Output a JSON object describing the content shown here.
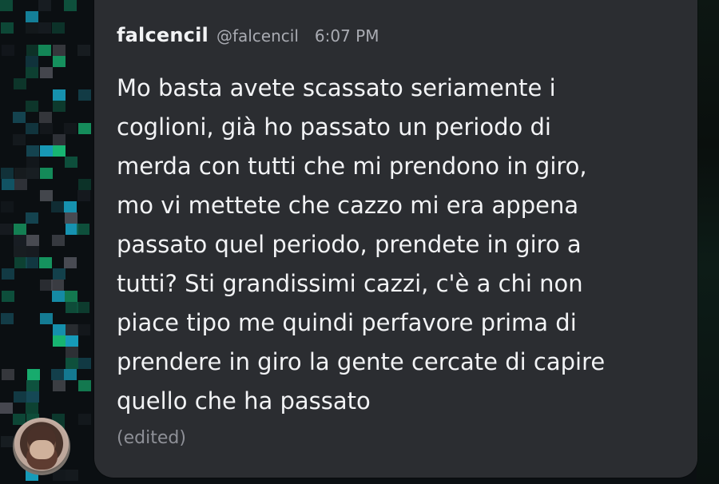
{
  "message": {
    "username": "falcencil",
    "handle": "@falcencil",
    "time": "6:07 PM",
    "text": "Mo basta avete scassato seriamente i\ncoglioni, già ho passato un periodo di\nmerda con tutti che mi prendono in giro,\nmo vi mettete che cazzo mi era appena\npassato quel periodo, prendete in giro a\ntutti? Sti grandissimi cazzi, c'è a chi non\npiace tipo me quindi perfavore prima di\nprendere in giro la gente cercate di capire\nquello che ha passato",
    "edited": "(edited)"
  },
  "colors": {
    "card": "#2b2d31",
    "text": "#f2f3f5",
    "muted": "#a9abb2",
    "background": "#0b0f12",
    "pixel_green": "#19c27a",
    "pixel_blue": "#18a7c8",
    "pixel_gray": "#4d4f56"
  },
  "icons": {
    "avatar": "user-avatar"
  }
}
